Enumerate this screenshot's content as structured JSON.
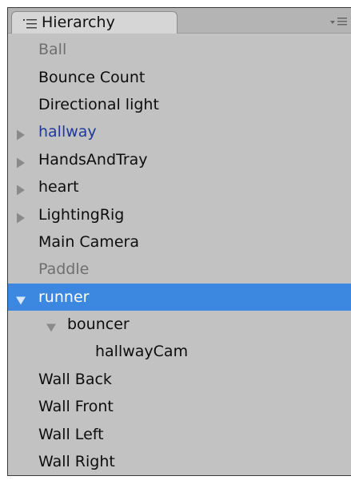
{
  "window": {
    "tab_title": "Hierarchy"
  },
  "tree": [
    {
      "label": "Ball",
      "depth": 0,
      "toggle": "none",
      "state": "inactive"
    },
    {
      "label": "Bounce Count",
      "depth": 0,
      "toggle": "none",
      "state": "normal"
    },
    {
      "label": "Directional light",
      "depth": 0,
      "toggle": "none",
      "state": "normal"
    },
    {
      "label": "hallway",
      "depth": 0,
      "toggle": "collapsed",
      "state": "prefab"
    },
    {
      "label": "HandsAndTray",
      "depth": 0,
      "toggle": "collapsed",
      "state": "normal"
    },
    {
      "label": "heart",
      "depth": 0,
      "toggle": "collapsed",
      "state": "normal"
    },
    {
      "label": "LightingRig",
      "depth": 0,
      "toggle": "collapsed",
      "state": "normal"
    },
    {
      "label": "Main Camera",
      "depth": 0,
      "toggle": "none",
      "state": "normal"
    },
    {
      "label": "Paddle",
      "depth": 0,
      "toggle": "none",
      "state": "inactive"
    },
    {
      "label": "runner",
      "depth": 0,
      "toggle": "expanded",
      "state": "selected"
    },
    {
      "label": "bouncer",
      "depth": 1,
      "toggle": "expanded",
      "state": "normal"
    },
    {
      "label": "hallwayCam",
      "depth": 2,
      "toggle": "none",
      "state": "normal"
    },
    {
      "label": "Wall Back",
      "depth": 0,
      "toggle": "none",
      "state": "normal"
    },
    {
      "label": "Wall Front",
      "depth": 0,
      "toggle": "none",
      "state": "normal"
    },
    {
      "label": "Wall Left",
      "depth": 0,
      "toggle": "none",
      "state": "normal"
    },
    {
      "label": "Wall Right",
      "depth": 0,
      "toggle": "none",
      "state": "normal"
    }
  ],
  "colors": {
    "panel_bg": "#c2c2c2",
    "selection": "#3c88e0",
    "prefab_text": "#1d3a9c",
    "inactive_text": "#6f6f6f",
    "arrow": "#8a8a8a"
  },
  "icons": {
    "tab": "list-icon",
    "menu": "panel-menu-icon",
    "toggle": "triangle-icon"
  }
}
